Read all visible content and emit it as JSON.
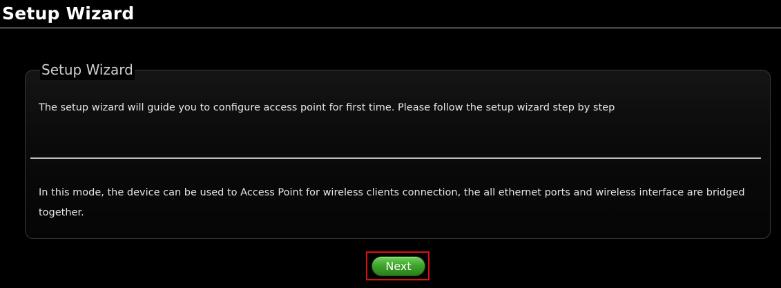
{
  "header": {
    "title": "Setup Wizard"
  },
  "panel": {
    "legend": "Setup Wizard",
    "intro_text": "The setup wizard will guide you to configure access point for first time. Please follow the setup wizard step by step",
    "mode_text": "In this mode, the device can be used to Access Point for wireless clients connection, the all ethernet ports and wireless interface are bridged together."
  },
  "actions": {
    "next_label": "Next"
  },
  "colors": {
    "background": "#000000",
    "accent_green": "#3ea52c",
    "highlight_red": "#e01010",
    "text": "#ffffff"
  }
}
